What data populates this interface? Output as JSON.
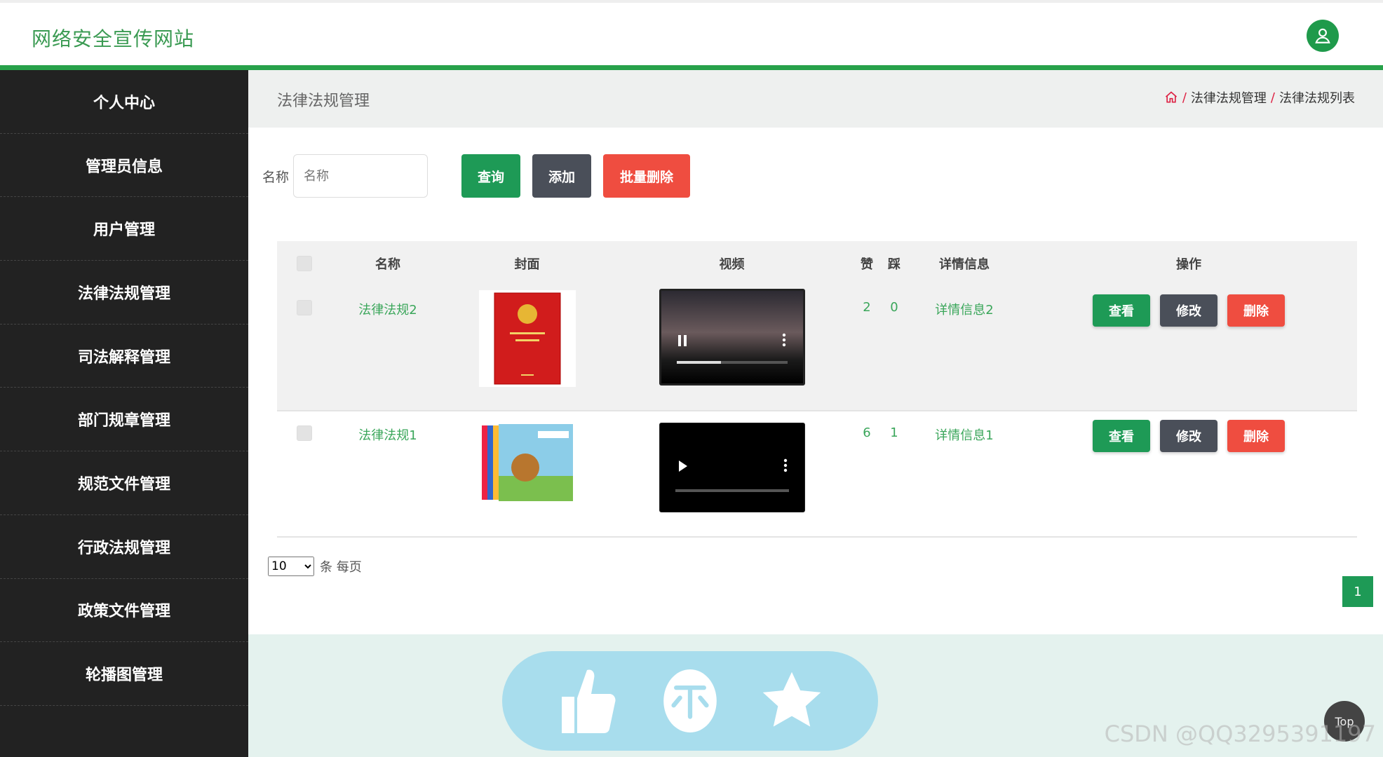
{
  "header": {
    "site_title": "网络安全宣传网站"
  },
  "sidebar": {
    "items": [
      {
        "label": "个人中心"
      },
      {
        "label": "管理员信息"
      },
      {
        "label": "用户管理"
      },
      {
        "label": "法律法规管理"
      },
      {
        "label": "司法解释管理"
      },
      {
        "label": "部门规章管理"
      },
      {
        "label": "规范文件管理"
      },
      {
        "label": "行政法规管理"
      },
      {
        "label": "政策文件管理"
      },
      {
        "label": "轮播图管理"
      }
    ]
  },
  "main": {
    "page_title": "法律法规管理",
    "breadcrumb": [
      "法律法规管理",
      "法律法规列表"
    ],
    "search": {
      "label": "名称",
      "placeholder": "名称",
      "query": "查询",
      "add": "添加",
      "batch_delete": "批量删除"
    },
    "table": {
      "headers": {
        "name": "名称",
        "cover": "封面",
        "video": "视频",
        "like": "赞",
        "dislike": "踩",
        "detail": "详情信息",
        "ops": "操作"
      },
      "rows": [
        {
          "name": "法律法规2",
          "like": "2",
          "dislike": "0",
          "detail": "详情信息2",
          "view": "查看",
          "edit": "修改",
          "del": "删除",
          "video_progress": 0.4
        },
        {
          "name": "法律法规1",
          "like": "6",
          "dislike": "1",
          "detail": "详情信息1",
          "view": "查看",
          "edit": "修改",
          "del": "删除",
          "video_progress": 0
        }
      ]
    },
    "pager": {
      "per_page": "10",
      "per_page_label": "条 每页",
      "current_page": "1"
    }
  },
  "footer": {
    "watermark": "CSDN @QQ3295391197",
    "top": "Top"
  },
  "colors": {
    "brand_green": "#1e9a56",
    "danger": "#ef4d40",
    "dark": "#4a4f59",
    "sidebar": "#222222"
  }
}
